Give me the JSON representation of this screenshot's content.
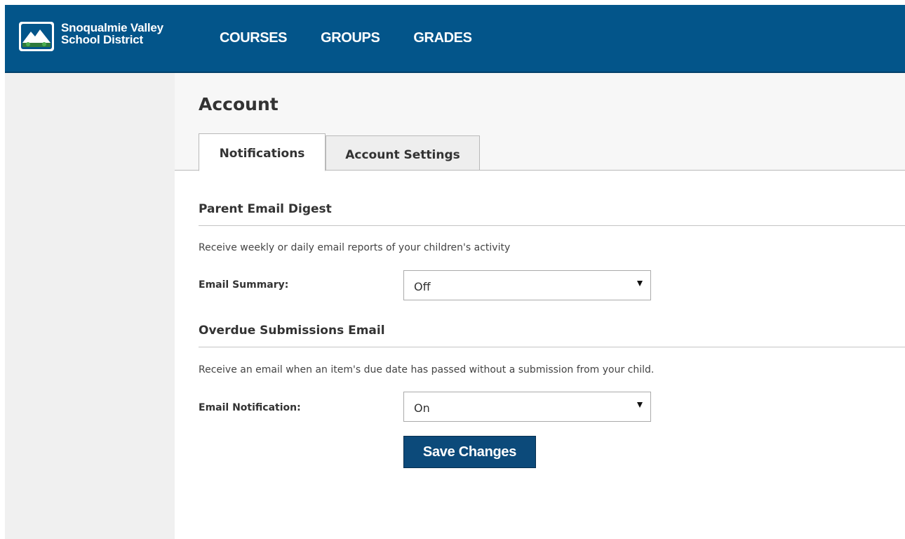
{
  "header": {
    "logo_line1": "Snoqualmie Valley",
    "logo_line2": "School District",
    "logo_icon": "mountain-seal-icon",
    "brand_color": "#03558a",
    "nav": [
      "COURSES",
      "GROUPS",
      "GRADES"
    ]
  },
  "page": {
    "title": "Account",
    "tabs": [
      {
        "label": "Notifications",
        "active": true
      },
      {
        "label": "Account Settings",
        "active": false
      }
    ]
  },
  "sections": [
    {
      "title": "Parent Email Digest",
      "description": "Receive weekly or daily email reports of your children's activity",
      "field_label": "Email Summary:",
      "value": "Off"
    },
    {
      "title": "Overdue Submissions Email",
      "description": "Receive an email when an item's due date has passed without a submission from your child.",
      "field_label": "Email Notification:",
      "value": "On"
    }
  ],
  "actions": {
    "save_label": "Save Changes"
  }
}
